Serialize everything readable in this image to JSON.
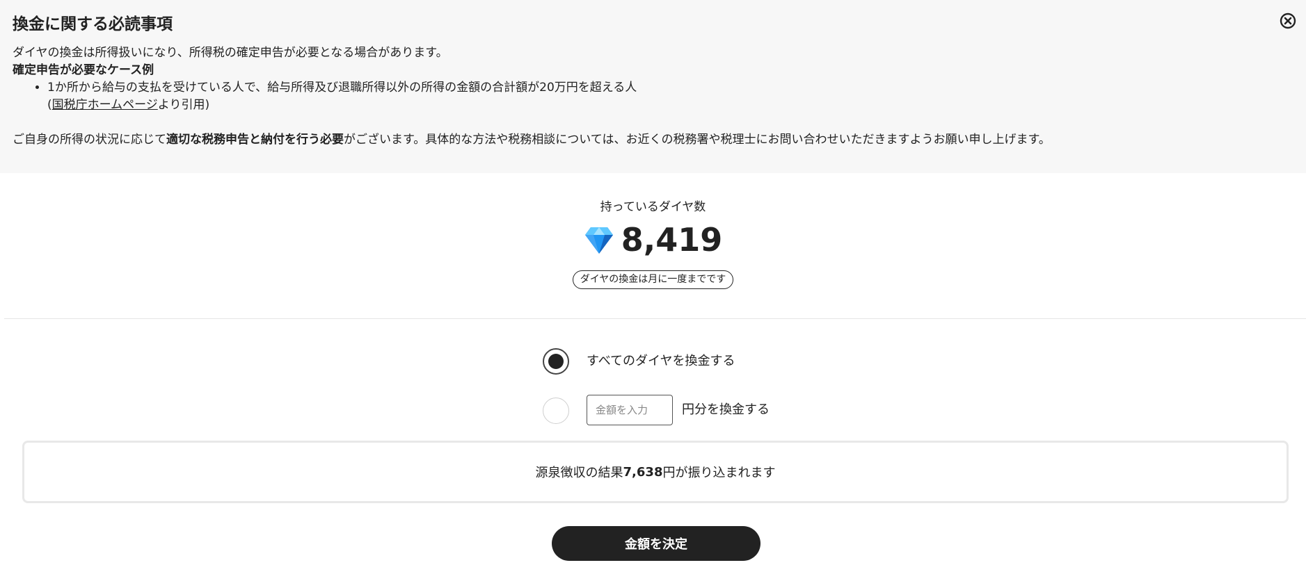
{
  "notice": {
    "title": "換金に関する必読事項",
    "intro": "ダイヤの換金は所得扱いになり、所得税の確定申告が必要となる場合があります。",
    "case_title": "確定申告が必要なケース例",
    "case_item": "1か所から給与の支払を受けている人で、給与所得及び退職所得以外の所得の金額の合計額が20万円を超える人",
    "cite_open": "(",
    "cite_link": "国税庁ホームページ",
    "cite_close": "より引用)",
    "body_pre": "ご自身の所得の状況に応じて",
    "body_bold": "適切な税務申告と納付を行う必要",
    "body_post": "がございます。具体的な方法や税務相談については、お近くの税務署や税理士にお問い合わせいただきますようお願い申し上げます。",
    "close_icon": "close-circle-icon"
  },
  "balance": {
    "label": "持っているダイヤ数",
    "value": "8,419",
    "icon": "diamond-icon",
    "note": "ダイヤの換金は月に一度までです"
  },
  "options": {
    "all_label": "すべてのダイヤを換金する",
    "all_selected": true,
    "amount_placeholder": "金額を入力",
    "amount_value": "",
    "amount_suffix": "円分を換金する"
  },
  "result": {
    "pre": "源泉徴収の結果",
    "amount": "7,638",
    "post": "円が振り込まれます"
  },
  "submit_label": "金額を決定",
  "colors": {
    "notice_bg": "#f7f7f7",
    "primary": "#222222",
    "gem_light": "#5fc8ff",
    "gem_dark": "#1e88e5"
  }
}
